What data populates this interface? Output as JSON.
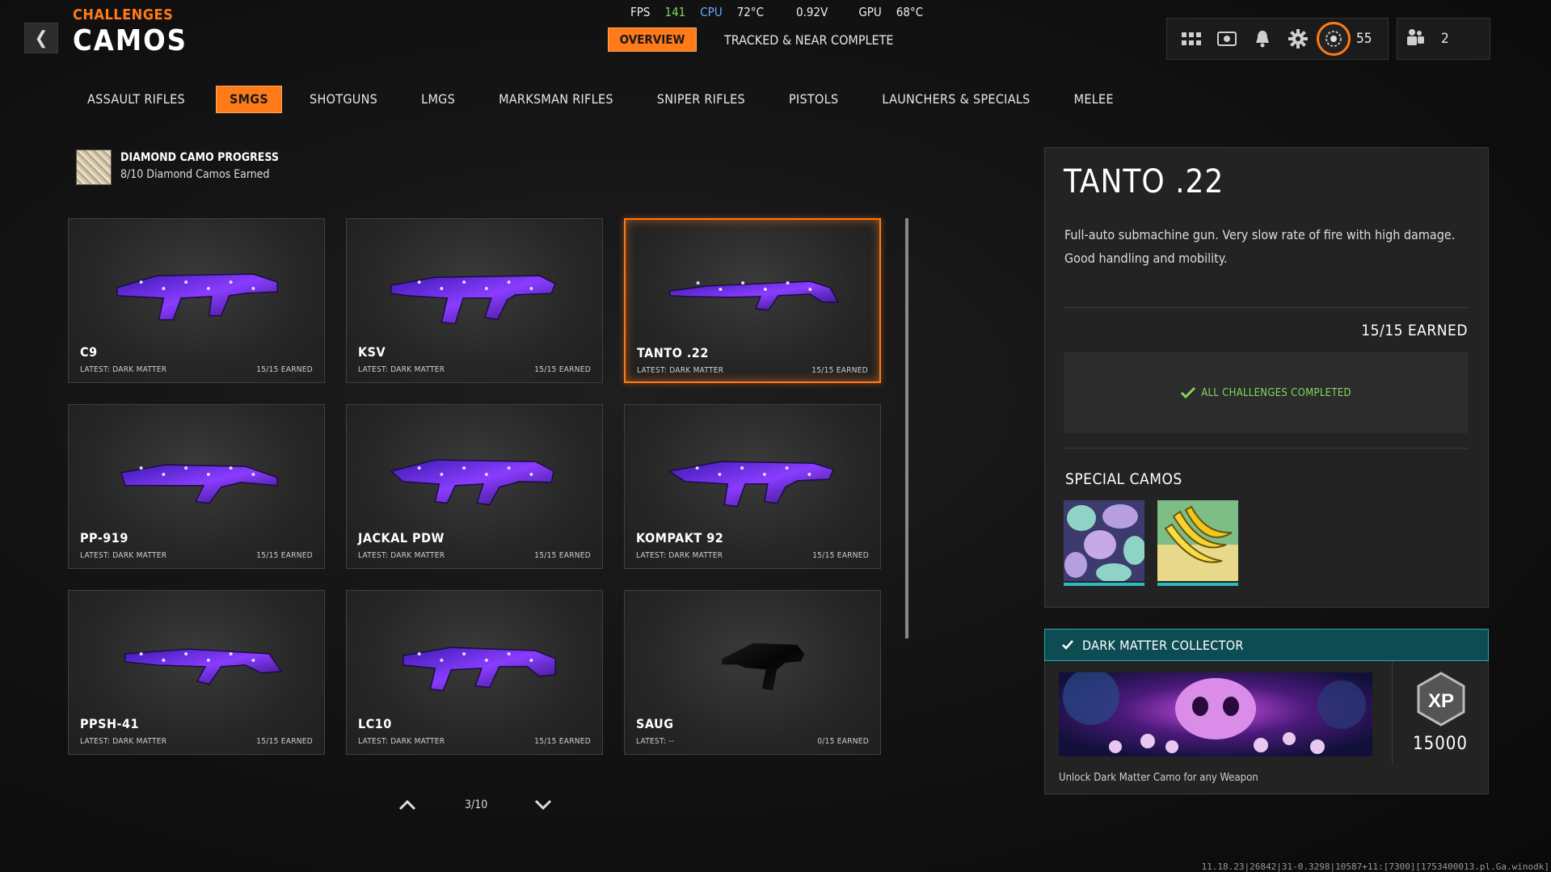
{
  "header": {
    "breadcrumb": "CHALLENGES",
    "title": "CAMOS",
    "back_icon": "chevron-left-icon",
    "overview_label": "OVERVIEW",
    "tracked_label": "TRACKED & NEAR COMPLETE",
    "level": "55",
    "party_count": "2"
  },
  "stats": {
    "fps_label": "FPS",
    "fps_value": "141",
    "cpu_label": "CPU",
    "cpu_temp": "72°C",
    "voltage": "0.92V",
    "gpu_label": "GPU",
    "gpu_temp": "68°C"
  },
  "tabs": [
    {
      "label": "ASSAULT RIFLES"
    },
    {
      "label": "SMGS",
      "active": true
    },
    {
      "label": "SHOTGUNS"
    },
    {
      "label": "LMGS"
    },
    {
      "label": "MARKSMAN RIFLES"
    },
    {
      "label": "SNIPER RIFLES"
    },
    {
      "label": "PISTOLS"
    },
    {
      "label": "LAUNCHERS & SPECIALS"
    },
    {
      "label": "MELEE"
    }
  ],
  "diamond": {
    "title": "DIAMOND CAMO PROGRESS",
    "subtitle": "8/10 Diamond Camos Earned"
  },
  "weapons": [
    {
      "name": "C9",
      "latest": "LATEST: DARK MATTER",
      "earned": "15/15 EARNED"
    },
    {
      "name": "KSV",
      "latest": "LATEST: DARK MATTER",
      "earned": "15/15 EARNED"
    },
    {
      "name": "TANTO .22",
      "latest": "LATEST: DARK MATTER",
      "earned": "15/15 EARNED",
      "selected": true
    },
    {
      "name": "PP-919",
      "latest": "LATEST: DARK MATTER",
      "earned": "15/15 EARNED"
    },
    {
      "name": "JACKAL PDW",
      "latest": "LATEST: DARK MATTER",
      "earned": "15/15 EARNED"
    },
    {
      "name": "KOMPAKT 92",
      "latest": "LATEST: DARK MATTER",
      "earned": "15/15 EARNED"
    },
    {
      "name": "PPSH-41",
      "latest": "LATEST: DARK MATTER",
      "earned": "15/15 EARNED"
    },
    {
      "name": "LC10",
      "latest": "LATEST: DARK MATTER",
      "earned": "15/15 EARNED"
    },
    {
      "name": "SAUG",
      "latest": "LATEST: --",
      "earned": "0/15 EARNED",
      "no_camo": true
    }
  ],
  "pager": {
    "text": "3/10"
  },
  "detail": {
    "title": "TANTO .22",
    "description": "Full-auto submachine gun.  Very slow rate of fire with high damage. Good handling and mobility.",
    "earned_total": "15/15 EARNED",
    "complete_text": "ALL CHALLENGES COMPLETED",
    "special_title": "SPECIAL CAMOS"
  },
  "reward": {
    "title": "DARK MATTER COLLECTOR",
    "xp_value": "15000",
    "description": "Unlock Dark Matter Camo for any Weapon"
  },
  "footer": {
    "build_text": "11.18.23|26842|31-0.3298|10587+11:[7300][1753400013.pl.Ga.winodk]"
  },
  "colors": {
    "accent": "#ff7a18",
    "complete_green": "#7ed957",
    "reward_teal": "#0e4c54",
    "camo_purple": "#6a2cff"
  }
}
